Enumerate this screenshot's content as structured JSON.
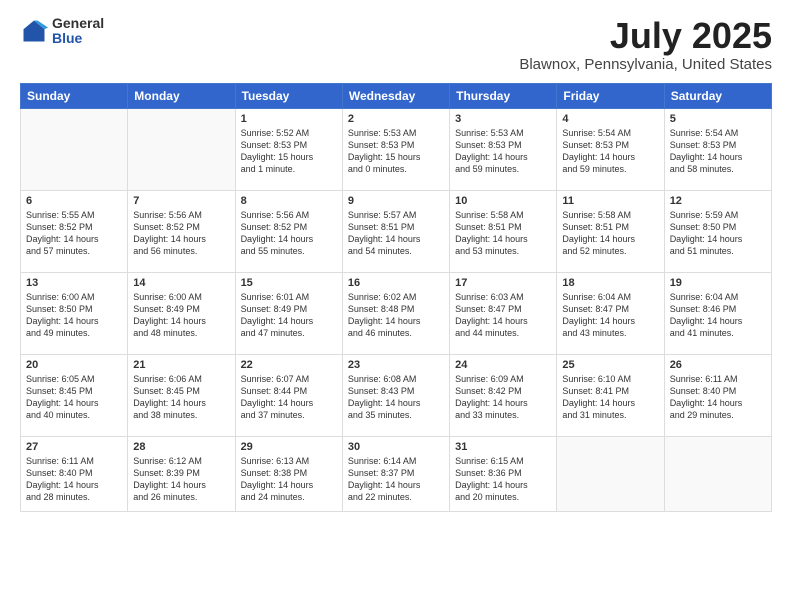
{
  "logo": {
    "general": "General",
    "blue": "Blue"
  },
  "title": {
    "month": "July 2025",
    "location": "Blawnox, Pennsylvania, United States"
  },
  "weekdays": [
    "Sunday",
    "Monday",
    "Tuesday",
    "Wednesday",
    "Thursday",
    "Friday",
    "Saturday"
  ],
  "weeks": [
    [
      {
        "day": "",
        "info": ""
      },
      {
        "day": "",
        "info": ""
      },
      {
        "day": "1",
        "info": "Sunrise: 5:52 AM\nSunset: 8:53 PM\nDaylight: 15 hours\nand 1 minute."
      },
      {
        "day": "2",
        "info": "Sunrise: 5:53 AM\nSunset: 8:53 PM\nDaylight: 15 hours\nand 0 minutes."
      },
      {
        "day": "3",
        "info": "Sunrise: 5:53 AM\nSunset: 8:53 PM\nDaylight: 14 hours\nand 59 minutes."
      },
      {
        "day": "4",
        "info": "Sunrise: 5:54 AM\nSunset: 8:53 PM\nDaylight: 14 hours\nand 59 minutes."
      },
      {
        "day": "5",
        "info": "Sunrise: 5:54 AM\nSunset: 8:53 PM\nDaylight: 14 hours\nand 58 minutes."
      }
    ],
    [
      {
        "day": "6",
        "info": "Sunrise: 5:55 AM\nSunset: 8:52 PM\nDaylight: 14 hours\nand 57 minutes."
      },
      {
        "day": "7",
        "info": "Sunrise: 5:56 AM\nSunset: 8:52 PM\nDaylight: 14 hours\nand 56 minutes."
      },
      {
        "day": "8",
        "info": "Sunrise: 5:56 AM\nSunset: 8:52 PM\nDaylight: 14 hours\nand 55 minutes."
      },
      {
        "day": "9",
        "info": "Sunrise: 5:57 AM\nSunset: 8:51 PM\nDaylight: 14 hours\nand 54 minutes."
      },
      {
        "day": "10",
        "info": "Sunrise: 5:58 AM\nSunset: 8:51 PM\nDaylight: 14 hours\nand 53 minutes."
      },
      {
        "day": "11",
        "info": "Sunrise: 5:58 AM\nSunset: 8:51 PM\nDaylight: 14 hours\nand 52 minutes."
      },
      {
        "day": "12",
        "info": "Sunrise: 5:59 AM\nSunset: 8:50 PM\nDaylight: 14 hours\nand 51 minutes."
      }
    ],
    [
      {
        "day": "13",
        "info": "Sunrise: 6:00 AM\nSunset: 8:50 PM\nDaylight: 14 hours\nand 49 minutes."
      },
      {
        "day": "14",
        "info": "Sunrise: 6:00 AM\nSunset: 8:49 PM\nDaylight: 14 hours\nand 48 minutes."
      },
      {
        "day": "15",
        "info": "Sunrise: 6:01 AM\nSunset: 8:49 PM\nDaylight: 14 hours\nand 47 minutes."
      },
      {
        "day": "16",
        "info": "Sunrise: 6:02 AM\nSunset: 8:48 PM\nDaylight: 14 hours\nand 46 minutes."
      },
      {
        "day": "17",
        "info": "Sunrise: 6:03 AM\nSunset: 8:47 PM\nDaylight: 14 hours\nand 44 minutes."
      },
      {
        "day": "18",
        "info": "Sunrise: 6:04 AM\nSunset: 8:47 PM\nDaylight: 14 hours\nand 43 minutes."
      },
      {
        "day": "19",
        "info": "Sunrise: 6:04 AM\nSunset: 8:46 PM\nDaylight: 14 hours\nand 41 minutes."
      }
    ],
    [
      {
        "day": "20",
        "info": "Sunrise: 6:05 AM\nSunset: 8:45 PM\nDaylight: 14 hours\nand 40 minutes."
      },
      {
        "day": "21",
        "info": "Sunrise: 6:06 AM\nSunset: 8:45 PM\nDaylight: 14 hours\nand 38 minutes."
      },
      {
        "day": "22",
        "info": "Sunrise: 6:07 AM\nSunset: 8:44 PM\nDaylight: 14 hours\nand 37 minutes."
      },
      {
        "day": "23",
        "info": "Sunrise: 6:08 AM\nSunset: 8:43 PM\nDaylight: 14 hours\nand 35 minutes."
      },
      {
        "day": "24",
        "info": "Sunrise: 6:09 AM\nSunset: 8:42 PM\nDaylight: 14 hours\nand 33 minutes."
      },
      {
        "day": "25",
        "info": "Sunrise: 6:10 AM\nSunset: 8:41 PM\nDaylight: 14 hours\nand 31 minutes."
      },
      {
        "day": "26",
        "info": "Sunrise: 6:11 AM\nSunset: 8:40 PM\nDaylight: 14 hours\nand 29 minutes."
      }
    ],
    [
      {
        "day": "27",
        "info": "Sunrise: 6:11 AM\nSunset: 8:40 PM\nDaylight: 14 hours\nand 28 minutes."
      },
      {
        "day": "28",
        "info": "Sunrise: 6:12 AM\nSunset: 8:39 PM\nDaylight: 14 hours\nand 26 minutes."
      },
      {
        "day": "29",
        "info": "Sunrise: 6:13 AM\nSunset: 8:38 PM\nDaylight: 14 hours\nand 24 minutes."
      },
      {
        "day": "30",
        "info": "Sunrise: 6:14 AM\nSunset: 8:37 PM\nDaylight: 14 hours\nand 22 minutes."
      },
      {
        "day": "31",
        "info": "Sunrise: 6:15 AM\nSunset: 8:36 PM\nDaylight: 14 hours\nand 20 minutes."
      },
      {
        "day": "",
        "info": ""
      },
      {
        "day": "",
        "info": ""
      }
    ]
  ]
}
